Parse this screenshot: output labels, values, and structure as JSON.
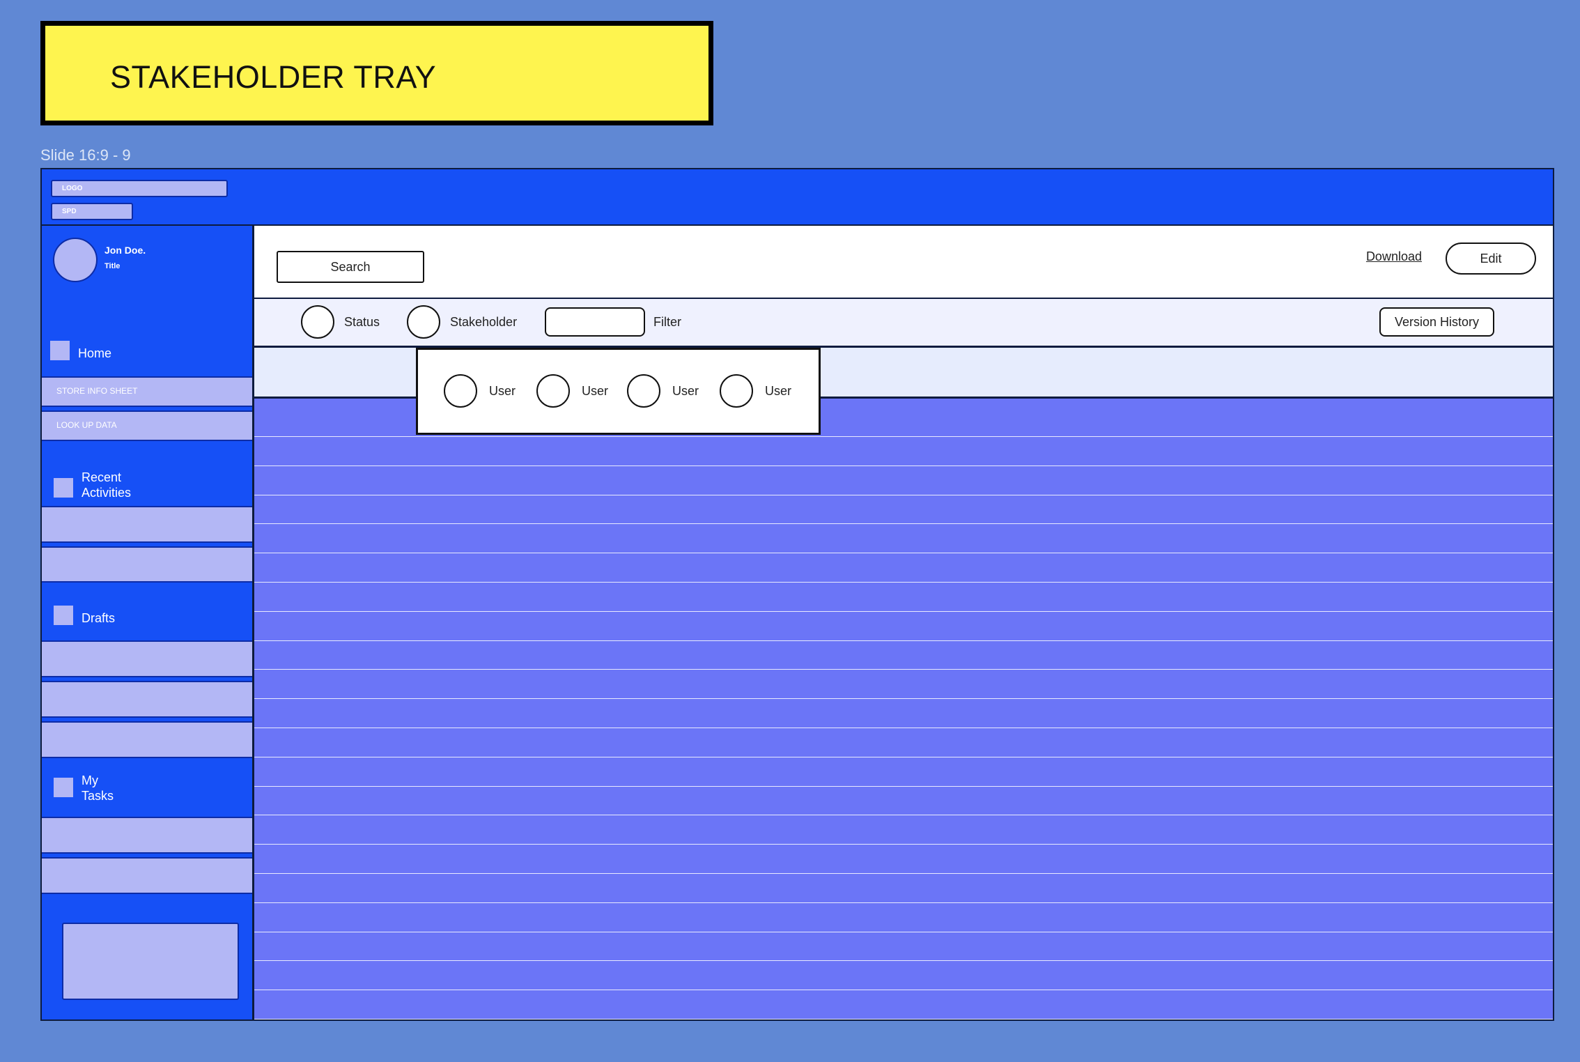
{
  "board": {
    "title": "STAKEHOLDER TRAY",
    "slide_label": "Slide 16:9 - 9"
  },
  "topbar": {
    "logo_label": "LOGO",
    "spd_label": "SPD"
  },
  "profile": {
    "name": "Jon Doe.",
    "title": "Title"
  },
  "sidebar": {
    "home_label": "Home",
    "store_info_label": "STORE INFO SHEET",
    "lookup_label": "LOOK UP DATA",
    "recent_line1": "Recent",
    "recent_line2": "Activities",
    "drafts_label": "Drafts",
    "tasks_line1": "My",
    "tasks_line2": "Tasks"
  },
  "header": {
    "search_label": "Search",
    "download_label": "Download",
    "edit_label": "Edit"
  },
  "filters": {
    "status_label": "Status",
    "stakeholder_label": "Stakeholder",
    "filter_label": "Filter",
    "version_history_label": "Version History"
  },
  "stakeholder_popover": {
    "users": [
      "User",
      "User",
      "User",
      "User"
    ]
  },
  "colors": {
    "background": "#6088d4",
    "primary_blue": "#1650f6",
    "lavender": "#b3b7f5",
    "grid_fill": "#6b75f7",
    "title_yellow": "#fef44f"
  }
}
